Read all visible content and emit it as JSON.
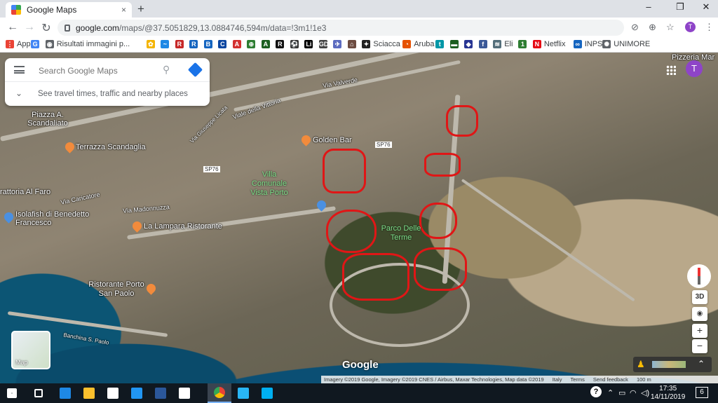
{
  "browser": {
    "tab_title": "Google Maps",
    "tab_close": "×",
    "new_tab": "+",
    "window_controls": [
      "–",
      "❐",
      "✕"
    ],
    "url_domain": "google.com",
    "url_path": "/maps/@37.5051829,13.0884746,594m/data=!3m1!1e3",
    "profile_initial": "T"
  },
  "bookmarks": [
    {
      "label": "App",
      "color": "#ea4335",
      "glyph": "⋮"
    },
    {
      "label": "",
      "color": "#4285f4",
      "glyph": "G"
    },
    {
      "label": "Risultati immagini p...",
      "color": "#5f6368",
      "glyph": "◉"
    },
    {
      "label": "",
      "color": "#f4b400",
      "glyph": "✿"
    },
    {
      "label": "",
      "color": "#1e88e5",
      "glyph": "~"
    },
    {
      "label": "",
      "color": "#c62828",
      "glyph": "R"
    },
    {
      "label": "",
      "color": "#1565c0",
      "glyph": "R"
    },
    {
      "label": "",
      "color": "#1565c0",
      "glyph": "B"
    },
    {
      "label": "",
      "color": "#0d47a1",
      "glyph": "C"
    },
    {
      "label": "",
      "color": "#d32f2f",
      "glyph": "A"
    },
    {
      "label": "",
      "color": "#2e7d32",
      "glyph": "⊕"
    },
    {
      "label": "",
      "color": "#1b5e20",
      "glyph": "A"
    },
    {
      "label": "",
      "color": "#111111",
      "glyph": "R"
    },
    {
      "label": "",
      "color": "#333333",
      "glyph": "⚽"
    },
    {
      "label": "",
      "color": "#000000",
      "glyph": "Li"
    },
    {
      "label": "",
      "color": "#444444",
      "glyph": "GDS"
    },
    {
      "label": "",
      "color": "#5c6bc0",
      "glyph": "✈"
    },
    {
      "label": "",
      "color": "#6d4c41",
      "glyph": "⌂"
    },
    {
      "label": "Sciacca",
      "color": "#212121",
      "glyph": "✦"
    },
    {
      "label": "Aruba",
      "color": "#e65100",
      "glyph": "◔"
    },
    {
      "label": "",
      "color": "#0097a7",
      "glyph": "t"
    },
    {
      "label": "",
      "color": "#1b5e20",
      "glyph": "▬"
    },
    {
      "label": "",
      "color": "#283593",
      "glyph": "◆"
    },
    {
      "label": "",
      "color": "#3b5998",
      "glyph": "f"
    },
    {
      "label": "Eli",
      "color": "#546e7a",
      "glyph": "≋"
    },
    {
      "label": "",
      "color": "#2e7d32",
      "glyph": "1"
    },
    {
      "label": "Netflix",
      "color": "#e50914",
      "glyph": "N"
    },
    {
      "label": "INPS",
      "color": "#1565c0",
      "glyph": "∞"
    },
    {
      "label": "UNIMORE",
      "color": "#5f6368",
      "glyph": "✺"
    }
  ],
  "search": {
    "placeholder": "Search Google Maps",
    "directions_hint": "See travel times, traffic and nearby places"
  },
  "map_labels": {
    "piazza": "Piazza A. Scandaliato",
    "terrazza": "Terrazza Scandaglia",
    "golden_bar": "Golden Bar",
    "villa": "Villa Comunale Vista Porto",
    "trattoria": "rattoria Al Faro",
    "isolafish": "Isolafish di Benedetto Francesco",
    "lampara": "La Lampara Ristorante",
    "ristorante_porto": "Ristorante Porto San Paolo",
    "parco": "Parco Delle Terme",
    "pizzeria": "Pizzeria Mar",
    "viale_vittoria": "Viale della Vittoria",
    "via_valverde": "Via Valverde",
    "via_madonnuzza": "Via Madonnuzza",
    "via_caricatore": "Via Caricatore",
    "via_lincoln": "Via Giuseppe Licata",
    "banchina": "Banchina S. Paolo",
    "sp76a": "SP76",
    "sp76b": "SP76"
  },
  "map_controls": {
    "apps_icon": "apps-grid-icon",
    "account_initial": "T",
    "view_3d": "3D",
    "zoom_in": "+",
    "zoom_out": "−",
    "layer_label": "Map",
    "google_logo": "Google",
    "attribution": "Imagery ©2019 Google, Imagery ©2019 CNES / Airbus, Maxar Technologies, Map data ©2019",
    "country": "Italy",
    "terms": "Terms",
    "feedback": "Send feedback",
    "scale": "100 m"
  },
  "taskbar": {
    "time": "17:35",
    "date": "14/11/2019",
    "notification_count": "6",
    "apps": [
      {
        "name": "start-icon",
        "color": "#ffffff"
      },
      {
        "name": "task-view-icon",
        "color": "#ffffff"
      },
      {
        "name": "edge-icon",
        "color": "#1e88e5"
      },
      {
        "name": "file-explorer-icon",
        "color": "#fbc02d"
      },
      {
        "name": "store-icon",
        "color": "#ffffff"
      },
      {
        "name": "dropbox-icon",
        "color": "#2196f3"
      },
      {
        "name": "word-icon",
        "color": "#2b579a"
      },
      {
        "name": "mail-icon",
        "color": "#ffffff"
      },
      {
        "name": "chrome-icon",
        "color": "#fbbc04"
      },
      {
        "name": "app-blue-icon",
        "color": "#29b6f6"
      },
      {
        "name": "skype-icon",
        "color": "#00aff0"
      }
    ]
  }
}
